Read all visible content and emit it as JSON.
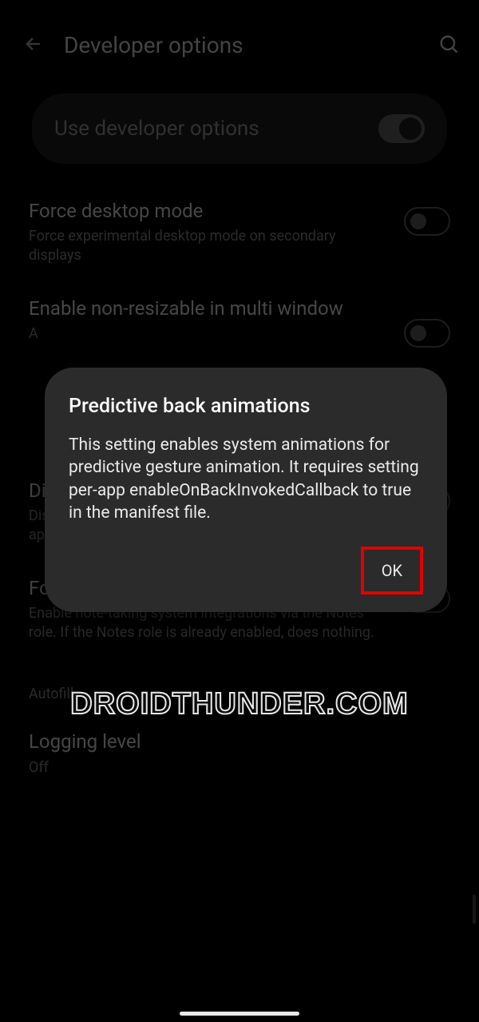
{
  "header": {
    "title": "Developer options"
  },
  "main_toggle": {
    "label": "Use developer options",
    "on": true
  },
  "settings": [
    {
      "title": "Force desktop mode",
      "desc": "Force experimental desktop mode on secondary displays",
      "on": false
    },
    {
      "title": "Enable non-resizable in multi window",
      "desc": "A",
      "on": false
    },
    {
      "title": "Disable child process restrictions",
      "desc": "Disable restrictions on the system resource usage of the app child processes",
      "on": false
    },
    {
      "title": "Force enable Notes role",
      "desc": "Enable note-taking system integrations via the Notes role. If the Notes role is already enabled, does nothing.",
      "on": false
    }
  ],
  "section_label": "Autofill",
  "logging": {
    "title": "Logging level",
    "value": "Off"
  },
  "dialog": {
    "title": "Predictive back animations",
    "body": "This setting enables system animations for predictive gesture animation. It requires setting per-app enableOnBackInvokedCallback to true in the manifest file.",
    "ok": "OK"
  },
  "watermark": "DROIDTHUNDER.COM"
}
